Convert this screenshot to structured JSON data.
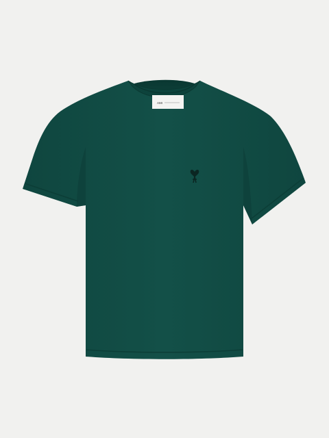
{
  "product": {
    "shirt_color": "#114c45",
    "shirt_shadow": "#0c3c36",
    "shirt_highlight": "#17594f",
    "collar_color": "#0f4841",
    "label_color": "#f4f4f2",
    "emblem_color": "#0b2622",
    "neck_label_text": "AMI",
    "emblem_icon": "ami-de-coeur-logo-icon"
  }
}
